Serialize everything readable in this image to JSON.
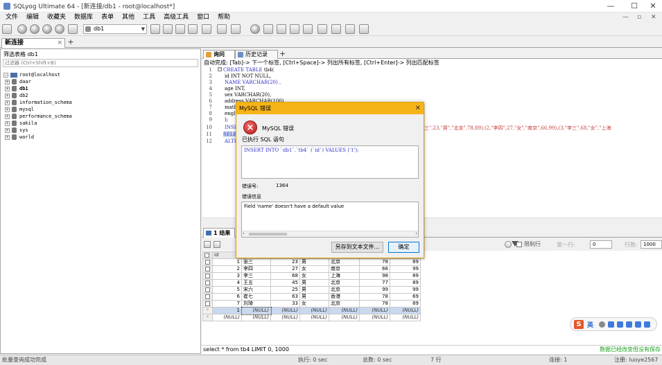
{
  "window": {
    "title": "SQLyog Ultimate 64 - [新连接/db1 - root@localhost*]",
    "minimize": "—",
    "maximize": "☐",
    "close": "✕"
  },
  "menubar": {
    "items": [
      "文件",
      "编辑",
      "收藏夹",
      "数据库",
      "表单",
      "其他",
      "工具",
      "高级工具",
      "窗口",
      "帮助"
    ],
    "mdi_controls": [
      "—",
      "▫",
      "✕"
    ]
  },
  "toolbar": {
    "db_select": "db1"
  },
  "connection_tab": {
    "label": "新连接",
    "close": "×",
    "add": "+"
  },
  "object_browser": {
    "filter_label": "筛选表格 db1",
    "filter_placeholder": "过滤器 (Ctrl+Shift+B)",
    "server": "root@localhost",
    "databases": [
      "daar",
      "db1",
      "db2",
      "information_schema",
      "mysql",
      "performance_schema",
      "sakila",
      "sys",
      "world"
    ]
  },
  "editor_tabs": {
    "query": "询问",
    "history": "历史记录",
    "add": "+"
  },
  "hint": "自动完成: [Tab]-> 下一个标签, [Ctrl+Space]-> 列出所有标签, [Ctrl+Enter]-> 列出匹配标签",
  "editor": {
    "line_numbers": [
      "1",
      "2",
      "3",
      "4",
      "5",
      "6",
      "7",
      "8",
      "9",
      "10",
      "11",
      "12"
    ],
    "lines": [
      {
        "kw": "CREATE TABLE ",
        "rest": "tb4("
      },
      {
        "kw": "",
        "rest": "id INT NOT NULL,"
      },
      {
        "kw": "",
        "rest": "NAME VARCHAR(20) ,"
      },
      {
        "kw": "",
        "rest": "age INT,"
      },
      {
        "kw": "",
        "rest": "sex VARCHAR(20),"
      },
      {
        "kw": "",
        "rest": "address VARCHAR(100),"
      },
      {
        "kw": "",
        "rest": "math"
      },
      {
        "kw": "",
        "rest": "engl"
      },
      {
        "kw": "",
        "rest": ");"
      },
      {
        "kw": "INSE",
        "rest": ""
      },
      {
        "kw": "SELE",
        "rest": ""
      },
      {
        "kw": "ALTE",
        "rest": ""
      }
    ],
    "line10_visible_tail": "三\",23,\"男\",\"北京\",78,89),(2,\"李四\",27,\"女\",\"南京\",66,99),(3,\"李三\",68,\"女\",\"上海"
  },
  "results": {
    "tab_label": "1 结果",
    "limit_label": "限制行",
    "first_row_label": "第一行:",
    "offset": "0",
    "rows_label": "行数:",
    "rows": "1000",
    "columns": [
      "id",
      "name",
      "age",
      "sex",
      "address",
      "math",
      "english"
    ],
    "data": [
      [
        "1",
        "张三",
        "23",
        "男",
        "北京",
        "78",
        "89"
      ],
      [
        "2",
        "李四",
        "27",
        "女",
        "南京",
        "66",
        "99"
      ],
      [
        "3",
        "李三",
        "68",
        "女",
        "上海",
        "98",
        "89"
      ],
      [
        "4",
        "王五",
        "45",
        "男",
        "北京",
        "77",
        "89"
      ],
      [
        "5",
        "宋六",
        "25",
        "男",
        "北京",
        "99",
        "99"
      ],
      [
        "6",
        "崔七",
        "63",
        "男",
        "香港",
        "78",
        "69"
      ],
      [
        "7",
        "刘琦",
        "33",
        "女",
        "北京",
        "78",
        "89"
      ],
      [
        "1",
        "(NULL)",
        "(NULL)",
        "(NULL)",
        "(NULL)",
        "(NULL)",
        "(NULL)"
      ],
      [
        "(NULL)",
        "(NULL)",
        "(NULL)",
        "(NULL)",
        "(NULL)",
        "(NULL)",
        "(NULL)"
      ]
    ],
    "sql": "select * from tb4 LIMIT 0, 1000",
    "status_msg": "数据已经改变但没有保存"
  },
  "statusbar": {
    "left": "批量查询成功完成",
    "exec": "执行: 0 sec",
    "total": "总数: 0 sec",
    "rows": "7 行",
    "line": "连接: 1",
    "user": "注册: luoye2567"
  },
  "ime": {
    "logo": "S",
    "lang": "英"
  },
  "dialog": {
    "title": "MySQL 错误",
    "close": "✕",
    "heading": "MySQL 错误",
    "executed_label": "已执行 SQL 语句",
    "sql": "INSERT INTO `db1`.`tb4` (`id`) VALUES ('1');",
    "errno_label": "错误号:",
    "errno": "1364",
    "errinfo_label": "错误信息",
    "message": "Field 'name' doesn't have a default value",
    "save_button": "另存到文本文件...",
    "ok_button": "确定"
  }
}
